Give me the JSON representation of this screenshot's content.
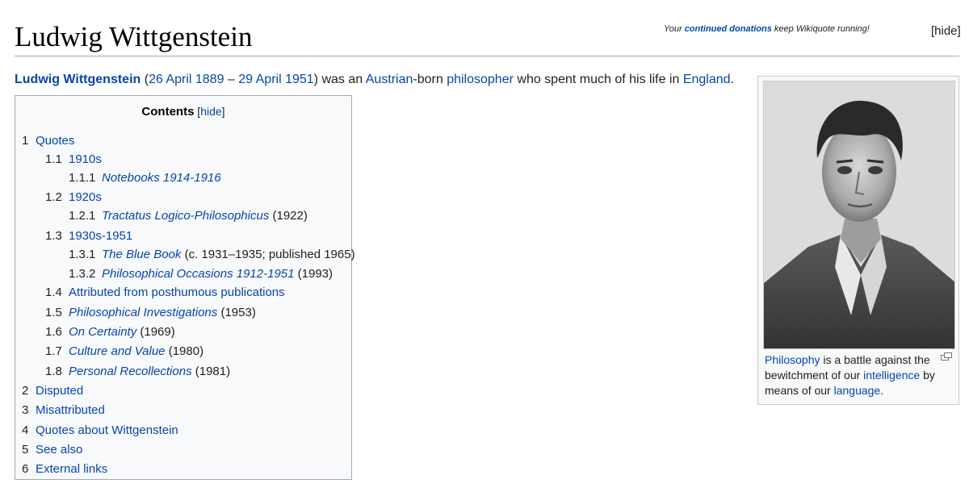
{
  "page": {
    "title": "Ludwig Wittgenstein"
  },
  "banner": {
    "prefix": "Your ",
    "link": "continued donations",
    "suffix": " keep Wikiquote running!",
    "hide": "[hide]"
  },
  "intro": {
    "name": "Ludwig Wittgenstein",
    "p1": " (",
    "birth": "26 April 1889",
    "dash": " – ",
    "death": "29 April 1951",
    "p2": ") was an ",
    "austrian": "Austrian",
    "p3": "-born ",
    "philosopher": "philosopher",
    "p4": " who spent much of his life in ",
    "england": "England",
    "p5": "."
  },
  "toc": {
    "title": "Contents",
    "hide_open": " [",
    "hide_link": "hide",
    "hide_close": "]",
    "items": [
      {
        "num": "1",
        "text": "Quotes",
        "italic": false,
        "suffix": ""
      },
      {
        "num": "1.1",
        "text": "1910s",
        "italic": false,
        "suffix": ""
      },
      {
        "num": "1.1.1",
        "text": "Notebooks 1914-1916",
        "italic": true,
        "suffix": ""
      },
      {
        "num": "1.2",
        "text": "1920s",
        "italic": false,
        "suffix": ""
      },
      {
        "num": "1.2.1",
        "text": "Tractatus Logico-Philosophicus",
        "italic": true,
        "suffix": " (1922)"
      },
      {
        "num": "1.3",
        "text": "1930s-1951",
        "italic": false,
        "suffix": ""
      },
      {
        "num": "1.3.1",
        "text": "The Blue Book",
        "italic": true,
        "suffix": " (c. 1931–1935; published 1965)"
      },
      {
        "num": "1.3.2",
        "text": "Philosophical Occasions 1912-1951",
        "italic": true,
        "suffix": " (1993)"
      },
      {
        "num": "1.4",
        "text": "Attributed from posthumous publications",
        "italic": false,
        "suffix": ""
      },
      {
        "num": "1.5",
        "text": "Philosophical Investigations",
        "italic": true,
        "suffix": " (1953)"
      },
      {
        "num": "1.6",
        "text": "On Certainty",
        "italic": true,
        "suffix": " (1969)"
      },
      {
        "num": "1.7",
        "text": "Culture and Value",
        "italic": true,
        "suffix": " (1980)"
      },
      {
        "num": "1.8",
        "text": "Personal Recollections",
        "italic": true,
        "suffix": " (1981)"
      },
      {
        "num": "2",
        "text": "Disputed",
        "italic": false,
        "suffix": ""
      },
      {
        "num": "3",
        "text": "Misattributed",
        "italic": false,
        "suffix": ""
      },
      {
        "num": "4",
        "text": "Quotes about Wittgenstein",
        "italic": false,
        "suffix": ""
      },
      {
        "num": "5",
        "text": "See also",
        "italic": false,
        "suffix": ""
      },
      {
        "num": "6",
        "text": "External links",
        "italic": false,
        "suffix": ""
      }
    ]
  },
  "thumb": {
    "photo_icon": "portrait-photo",
    "caption": {
      "philosophy": "Philosophy",
      "t1": " is a battle against the bewitchment of our ",
      "intelligence": "intelligence",
      "t2": " by means of our ",
      "language": "language",
      "t3": "."
    },
    "enlarge_icon": "enlarge-icon"
  }
}
